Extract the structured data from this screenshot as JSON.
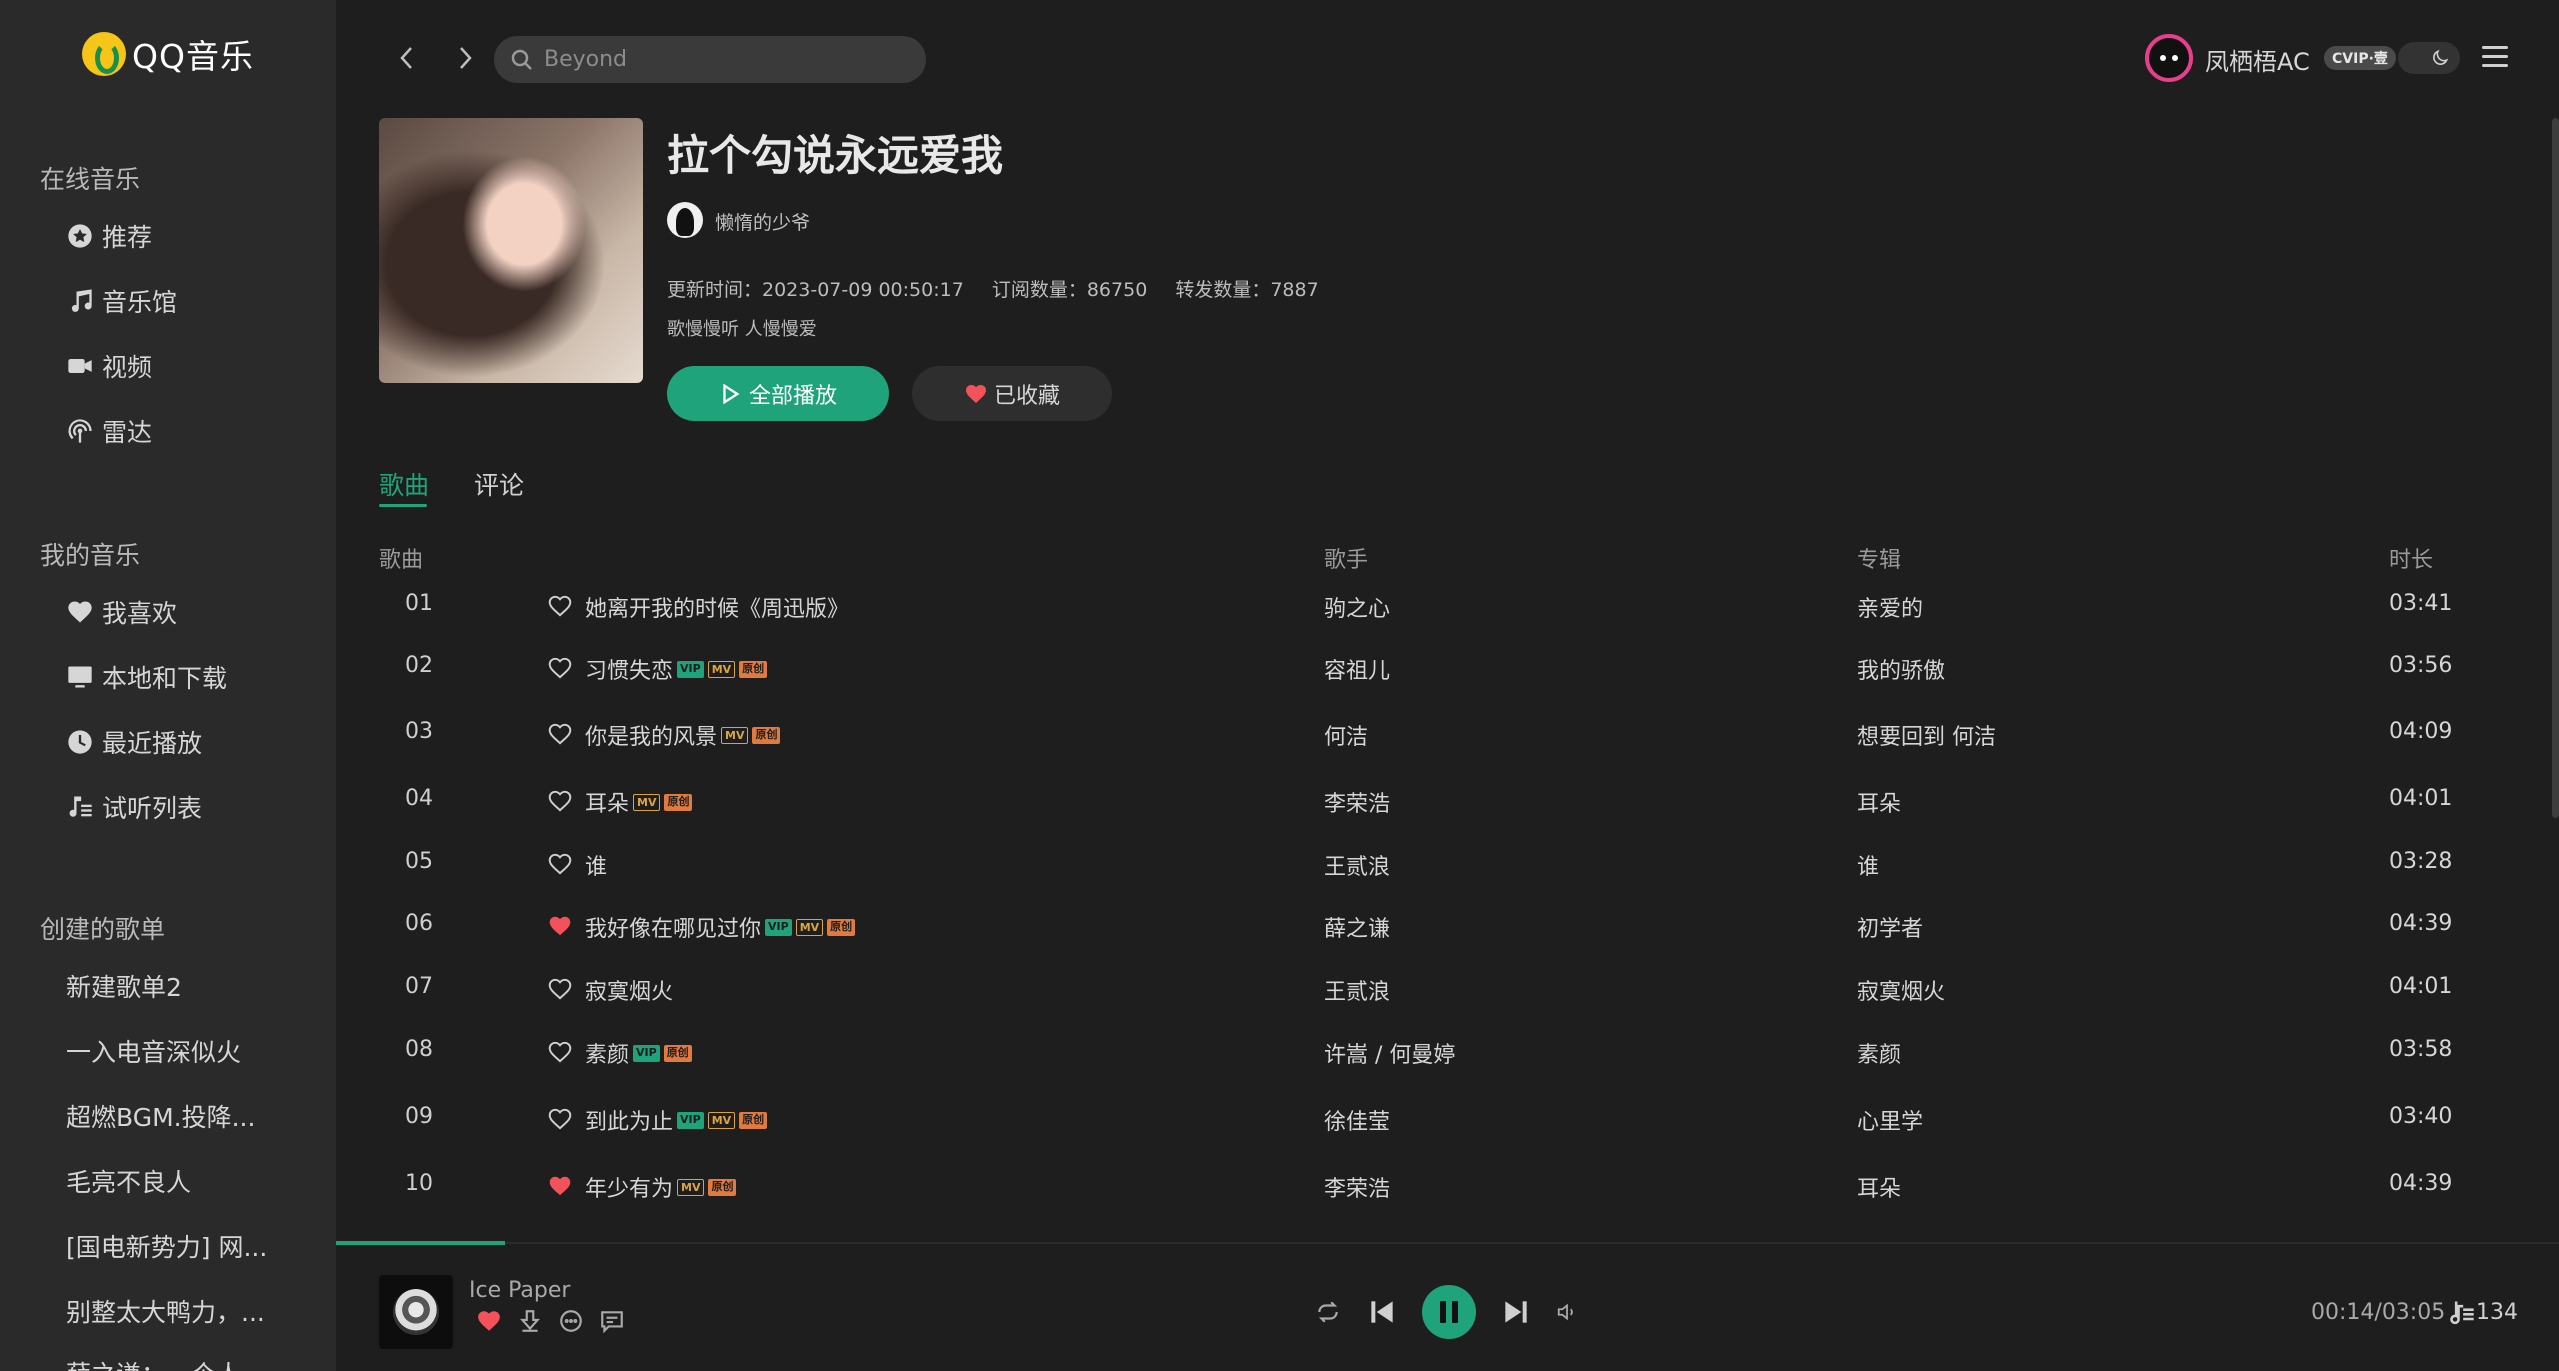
{
  "app": {
    "name": "QQ音乐"
  },
  "sidebar": {
    "online_title": "在线音乐",
    "online_items": [
      {
        "label": "推荐",
        "icon": "star-circle-icon"
      },
      {
        "label": "音乐馆",
        "icon": "music-note-icon"
      },
      {
        "label": "视频",
        "icon": "video-camera-icon"
      },
      {
        "label": "雷达",
        "icon": "radar-icon"
      }
    ],
    "my_title": "我的音乐",
    "my_items": [
      {
        "label": "我喜欢",
        "icon": "heart-icon"
      },
      {
        "label": "本地和下载",
        "icon": "monitor-icon"
      },
      {
        "label": "最近播放",
        "icon": "clock-icon"
      },
      {
        "label": "试听列表",
        "icon": "playlist-icon"
      }
    ],
    "created_title": "创建的歌单",
    "playlists": [
      "新建歌单2",
      "一入电音深似火",
      "超燃BGM.投降...",
      "毛亮不良人",
      "[国电新势力] 网...",
      "别整太大鸭力，...",
      "薛之谦：一个人"
    ]
  },
  "topbar": {
    "search_placeholder": "Beyond",
    "user_name": "凤栖梧AC",
    "vip_badge": "CVIP·壹"
  },
  "playlist": {
    "title": "拉个勾说永远爱我",
    "creator": "懒惰的少爷",
    "update_label": "更新时间：2023-07-09 00:50:17",
    "subscribe_label": "订阅数量：86750",
    "share_label": "转发数量：7887",
    "description": "歌慢慢听 人慢慢爱",
    "play_all_label": "全部播放",
    "favorited_label": "已收藏"
  },
  "tabs": {
    "songs": "歌曲",
    "comments": "评论"
  },
  "table": {
    "headers": {
      "song": "歌曲",
      "singer": "歌手",
      "album": "专辑",
      "duration": "时长"
    },
    "rows": [
      {
        "idx": "01",
        "name": "她离开我的时候《周迅版》",
        "liked": false,
        "vip": false,
        "mv": false,
        "orig": false,
        "singer": "驹之心",
        "album": "亲爱的",
        "duration": "03:41"
      },
      {
        "idx": "02",
        "name": "习惯失恋",
        "liked": false,
        "vip": true,
        "mv": true,
        "orig": true,
        "singer": "容祖儿",
        "album": "我的骄傲",
        "duration": "03:56"
      },
      {
        "idx": "03",
        "name": "你是我的风景",
        "liked": false,
        "vip": false,
        "mv": true,
        "orig": true,
        "singer": "何洁",
        "album": "想要回到 何洁",
        "duration": "04:09"
      },
      {
        "idx": "04",
        "name": "耳朵",
        "liked": false,
        "vip": false,
        "mv": true,
        "orig": true,
        "singer": "李荣浩",
        "album": "耳朵",
        "duration": "04:01"
      },
      {
        "idx": "05",
        "name": "谁",
        "liked": false,
        "vip": false,
        "mv": false,
        "orig": false,
        "singer": "王贰浪",
        "album": "谁",
        "duration": "03:28"
      },
      {
        "idx": "06",
        "name": "我好像在哪见过你",
        "liked": true,
        "vip": true,
        "mv": true,
        "orig": true,
        "singer": "薛之谦",
        "album": "初学者",
        "duration": "04:39"
      },
      {
        "idx": "07",
        "name": "寂寞烟火",
        "liked": false,
        "vip": false,
        "mv": false,
        "orig": false,
        "singer": "王贰浪",
        "album": "寂寞烟火",
        "duration": "04:01"
      },
      {
        "idx": "08",
        "name": "素颜",
        "liked": false,
        "vip": true,
        "mv": false,
        "orig": true,
        "singer": "许嵩 / 何曼婷",
        "album": "素颜",
        "duration": "03:58"
      },
      {
        "idx": "09",
        "name": "到此为止",
        "liked": false,
        "vip": true,
        "mv": true,
        "orig": true,
        "singer": "徐佳莹",
        "album": "心里学",
        "duration": "03:40"
      },
      {
        "idx": "10",
        "name": "年少有为",
        "liked": true,
        "vip": false,
        "mv": true,
        "orig": true,
        "singer": "李荣浩",
        "album": "耳朵",
        "duration": "04:39"
      }
    ],
    "tag_labels": {
      "vip": "VIP",
      "mv": "MV",
      "orig": "原创"
    }
  },
  "player": {
    "track_title": "Ice Paper",
    "time": "00:14/03:05",
    "queue_count": "134",
    "progress_fraction": 0.076
  },
  "colors": {
    "accent": "#1fa37a",
    "like": "#f4525a",
    "sidebar_bg": "#2a2a2a",
    "main_bg": "#1e1e1e"
  }
}
